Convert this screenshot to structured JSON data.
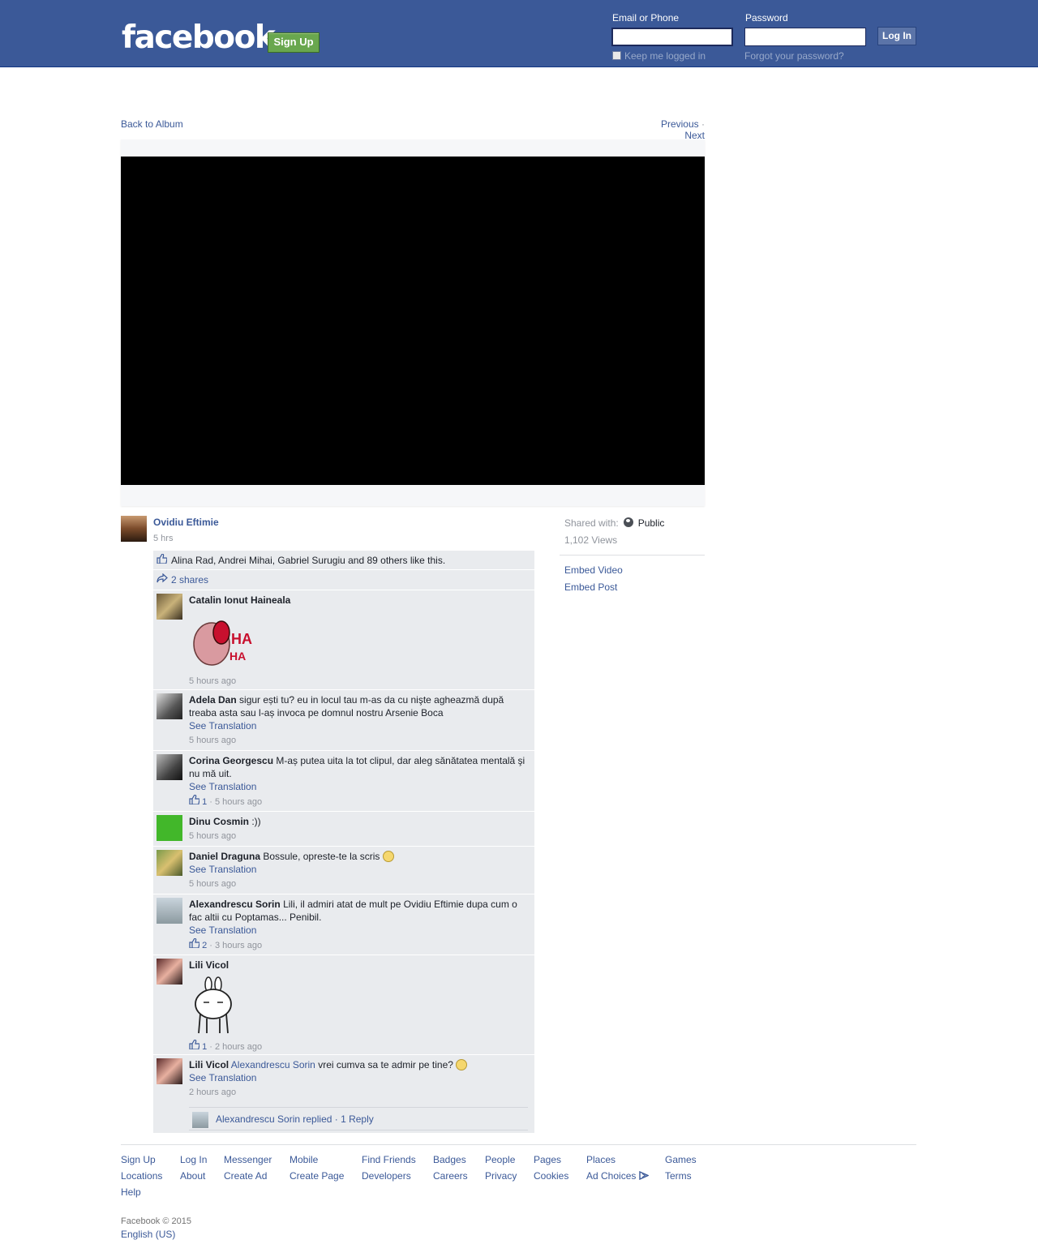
{
  "header": {
    "logo": "facebook",
    "signup_label": "Sign Up",
    "email_label": "Email or Phone",
    "password_label": "Password",
    "login_label": "Log In",
    "keep_logged": "Keep me logged in",
    "forgot": "Forgot your password?"
  },
  "nav": {
    "back": "Back to Album",
    "previous": "Previous",
    "separator": "·",
    "next": "Next"
  },
  "post": {
    "author": "Ovidiu Eftimie",
    "time": "5 hrs",
    "likes_text": "Alina Rad, Andrei Mihai, Gabriel Surugiu and 89 others like this.",
    "shares_text": "2 shares"
  },
  "sidebar": {
    "shared_label": "Shared with:",
    "privacy": "Public",
    "views": "1,102 Views",
    "embed_video": "Embed Video",
    "embed_post": "Embed Post"
  },
  "comments": [
    {
      "name": "Catalin Ionut Haineala",
      "text": "",
      "time": "5 hours ago"
    },
    {
      "name": "Adela Dan",
      "text": "sigur ești tu? eu in locul tau m-as da cu nişte agheazmă după treaba asta sau l-aș invoca pe domnul nostru Arsenie Boca",
      "see_translation": "See Translation",
      "time": "5 hours ago"
    },
    {
      "name": "Corina Georgescu",
      "text": "M-aș putea uita la tot clipul, dar aleg sănătatea mentală şi nu mă uit.",
      "see_translation": "See Translation",
      "likes": "1",
      "time": "· 5 hours ago"
    },
    {
      "name": "Dinu Cosmin",
      "text": ":))",
      "time": "5 hours ago"
    },
    {
      "name": "Daniel Draguna",
      "text": "Bossule, opreste-te la scris",
      "see_translation": "See Translation",
      "time": "5 hours ago"
    },
    {
      "name": "Alexandrescu Sorin",
      "text": "Lili, il admiri atat de mult pe Ovidiu Eftimie dupa cum o fac altii cu Poptamas... Penibil.",
      "see_translation": "See Translation",
      "likes": "2",
      "time": "· 3 hours ago"
    },
    {
      "name": "Lili Vicol",
      "text": "",
      "likes": "1",
      "time": "· 2 hours ago"
    },
    {
      "name": "Lili Vicol",
      "mention": "Alexandrescu Sorin",
      "text": "vrei cumva sa te admir pe tine?",
      "see_translation": "See Translation",
      "time": "2 hours ago",
      "reply_text": "Alexandrescu Sorin replied · 1 Reply"
    }
  ],
  "footer": {
    "row1": [
      "Sign Up",
      "Log In",
      "Messenger",
      "Mobile",
      "Find Friends",
      "Badges",
      "People",
      "Pages",
      "Places",
      "Games"
    ],
    "row2": [
      "Locations",
      "About",
      "Create Ad",
      "Create Page",
      "Developers",
      "Careers",
      "Privacy",
      "Cookies",
      "Ad Choices",
      "Terms"
    ],
    "row3": [
      "Help"
    ],
    "copyright": "Facebook © 2015",
    "language": "English (US)"
  },
  "colors": {
    "brand": "#3b5998",
    "signup_green": "#69a74e",
    "panel_bg": "#e9ebee"
  }
}
